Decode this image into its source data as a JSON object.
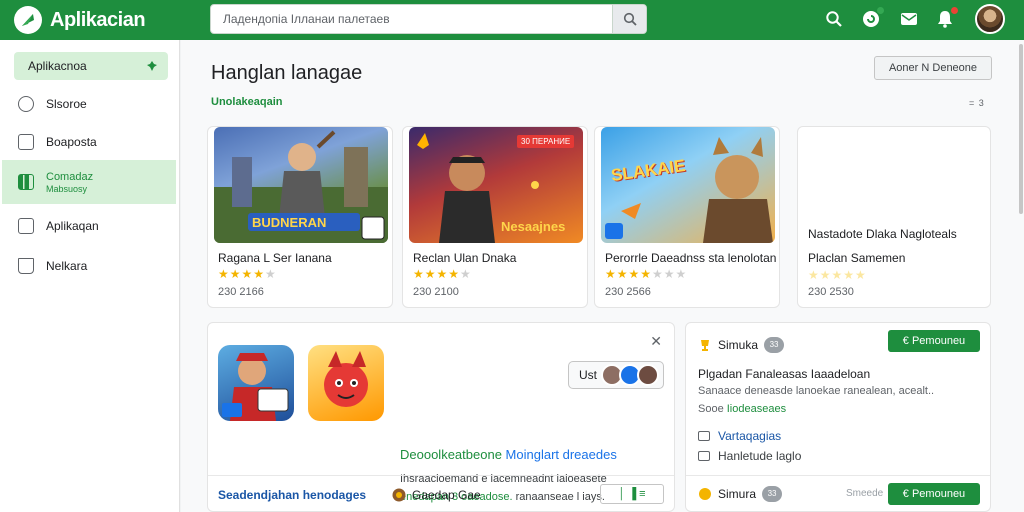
{
  "app": {
    "title": "Aplikacian"
  },
  "search": {
    "value": "Ладендопіа Ілланаи палетаев"
  },
  "sidebar": {
    "top_label": "Aplikacnoa",
    "items": [
      {
        "label": "Slsoroe",
        "icon": "chat-bubble-icon"
      },
      {
        "label": "Boaposta",
        "icon": "clipboard-icon"
      },
      {
        "label": "Comadaz",
        "sub": "Mabsuosy",
        "icon": "library-icon",
        "active": true
      },
      {
        "label": "Aplikaqan",
        "icon": "app-icon"
      },
      {
        "label": "Nelkara",
        "icon": "bookmark-icon"
      }
    ]
  },
  "main": {
    "title": "Hanglan lanagae",
    "section_label": "Unolakeaqain",
    "top_button": "Aoner N Deneone",
    "dots_1": "= 3",
    "dots_2": "= 3"
  },
  "cards": [
    {
      "title": "Ragana L Ser Ianana",
      "meta": "230 2166",
      "thumb_text": "BUDNERAN",
      "badge": ""
    },
    {
      "title": "Reclan Ulan Dnaka",
      "meta": "230 2100",
      "thumb_text": "Nesaajnes",
      "badge": "30 ПЕРАНИЕ"
    },
    {
      "title": "Perorrle Daeadnss sta lenolotan",
      "meta": "230 2566",
      "thumb_text": "SLAKAIE",
      "badge": ""
    },
    {
      "title": "Nastadote Dlaka Nagloteals",
      "subtitle": "Placlan Samemen",
      "meta": "230 2530"
    }
  ],
  "promo": {
    "title_green": "Deooolkeatbeone",
    "title_blue": "Moinglart dreaedes",
    "line1": "Ihsraacloemand e lacemneadnt laloeasete",
    "line2_green": "enedapan 3  oaeadose.",
    "line2_rest": " ranaanseae l iays.",
    "pill_label": "Ust",
    "footer_link": "Seadendjahan henodages",
    "footer_mid": "Gaedap Gae",
    "footer_ctrl": "│ ▐ ≡"
  },
  "right_panel": {
    "head_label": "Simuka",
    "head_count": "33",
    "button1": "€ Pemouneu",
    "title": "Plgadan Fanaleasas Iaaadeloan",
    "desc1": "Sanaace deneasde lanoekae ranealean, acealt..",
    "desc2_plain": "Sooe ",
    "desc2_green": "Iiodeaseaes",
    "check1": "Vartaqagias",
    "check2": "Hanletude laglo",
    "foot_label": "Simura",
    "foot_count": "33",
    "foot_extra": "Smeede",
    "button2": "€ Pemouneu"
  },
  "colors": {
    "brand": "#1e8e3e",
    "star": "#f4b400",
    "link": "#1a73e8"
  }
}
